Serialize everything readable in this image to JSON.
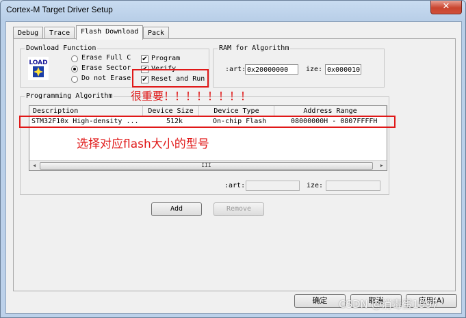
{
  "window": {
    "title": "Cortex-M Target Driver Setup",
    "close_glyph": "✕"
  },
  "tabs": [
    {
      "label": "Debug"
    },
    {
      "label": "Trace"
    },
    {
      "label": "Flash Download",
      "active": true
    },
    {
      "label": "Pack"
    }
  ],
  "download_function": {
    "title": "Download Function",
    "icon_text": "LOAD",
    "radios": [
      {
        "label": "Erase Full C",
        "checked": false
      },
      {
        "label": "Erase Sector",
        "checked": true
      },
      {
        "label": "Do not Erase",
        "checked": false
      }
    ],
    "checks": [
      {
        "label": "Program",
        "checked": true
      },
      {
        "label": "Verify",
        "checked": true
      },
      {
        "label": "Reset and Run",
        "checked": true
      }
    ],
    "check_glyph": "✔"
  },
  "ram": {
    "title": "RAM for Algorithm",
    "start_label": ":art:",
    "start_value": "0x20000000",
    "size_label": "ize:",
    "size_value": "0x000010"
  },
  "programming_algorithm": {
    "title": "Programming Algorithm",
    "columns": [
      "Description",
      "Device Size",
      "Device Type",
      "Address Range"
    ],
    "rows": [
      {
        "description": "STM32F10x High-density ...",
        "size": "512k",
        "type": "On-chip Flash",
        "range": "08000000H - 0807FFFFH"
      }
    ],
    "scroll_left": "◀",
    "scroll_right": "▶",
    "thumb_grip": "III",
    "start_label": ":art:",
    "start_value": "",
    "size_label": "ize:",
    "size_value": ""
  },
  "buttons": {
    "add": "Add",
    "remove": "Remove",
    "ok": "确定",
    "cancel": "取消",
    "apply": "应用(A)"
  },
  "annotations": {
    "important": "很重要！！！！！！！！",
    "select_model": "选择对应flash大小的型号"
  },
  "watermark": "CSDN @消毒蛋1997",
  "colors": {
    "annotation_red": "#e01818",
    "close_red": "#c9452f"
  }
}
